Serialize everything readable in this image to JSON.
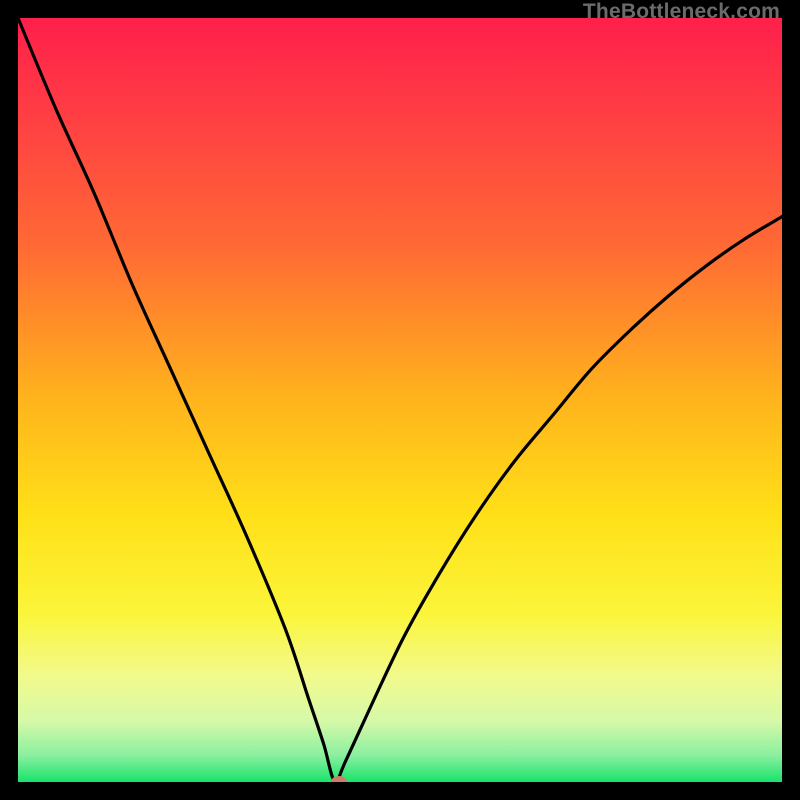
{
  "watermark": "TheBottleneck.com",
  "chart_data": {
    "type": "line",
    "title": "",
    "xlabel": "",
    "ylabel": "",
    "xlim": [
      0,
      100
    ],
    "ylim": [
      0,
      100
    ],
    "series": [
      {
        "name": "bottleneck-curve",
        "x": [
          0,
          5,
          10,
          15,
          20,
          25,
          30,
          35,
          38,
          40,
          41.5,
          43,
          50,
          55,
          60,
          65,
          70,
          75,
          80,
          85,
          90,
          95,
          100
        ],
        "values": [
          100,
          88,
          77,
          65,
          54,
          43,
          32,
          20,
          11,
          5,
          0,
          3,
          18,
          27,
          35,
          42,
          48,
          54,
          59,
          63.5,
          67.5,
          71,
          74
        ]
      }
    ],
    "marker": {
      "x": 42,
      "y": 0,
      "color": "#cf7a6a"
    },
    "gradient_stops": [
      {
        "offset": 0.0,
        "color": "#ff1f4b"
      },
      {
        "offset": 0.12,
        "color": "#ff3c44"
      },
      {
        "offset": 0.3,
        "color": "#ff6a34"
      },
      {
        "offset": 0.5,
        "color": "#ffb41c"
      },
      {
        "offset": 0.65,
        "color": "#ffe018"
      },
      {
        "offset": 0.78,
        "color": "#fbf53a"
      },
      {
        "offset": 0.86,
        "color": "#f2fa8b"
      },
      {
        "offset": 0.92,
        "color": "#d6f9a8"
      },
      {
        "offset": 0.965,
        "color": "#8af0a0"
      },
      {
        "offset": 1.0,
        "color": "#19e36a"
      }
    ]
  }
}
